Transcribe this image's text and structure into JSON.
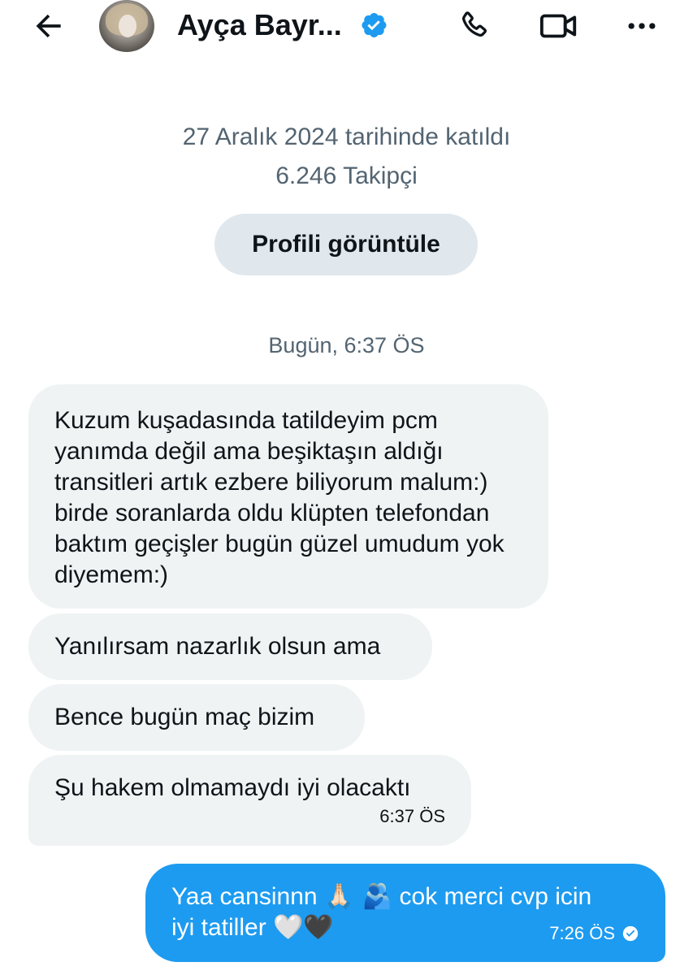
{
  "header": {
    "name": "Ayça Bayr...",
    "icons": [
      "back-arrow-icon",
      "verified-badge-icon",
      "phone-icon",
      "video-camera-icon",
      "more-icon"
    ]
  },
  "profile": {
    "joined": "27 Aralık 2024 tarihinde katıldı",
    "followers": "6.246 Takipçi",
    "view_profile_label": "Profili görüntüle"
  },
  "conversation": {
    "day_stamp": "Bugün, 6:37 ÖS",
    "incoming": [
      "Kuzum kuşadasında tatildeyim pcm yanımda değil ama beşiktaşın aldığı transitleri artık ezbere biliyorum malum:) birde soranlarda oldu klüpten telefondan baktım geçişler bugün güzel umudum yok diyemem:)",
      "Yanılırsam nazarlık olsun ama",
      "Bence bugün maç bizim",
      "Şu hakem olmamaydı iyi olacaktı"
    ],
    "incoming_time": "6:37 ÖS",
    "outgoing": {
      "text_part1": "Yaa cansinnn",
      "emoji_part1": "🙏🏻 🫂",
      "text_part2": "cok merci cvp icin",
      "text_line2": "iyi tatiller",
      "emoji_part2": "🤍🖤",
      "time": "7:26 ÖS"
    }
  },
  "colors": {
    "accent": "#1d9bf0",
    "incoming_bubble": "#eff3f4",
    "secondary_text": "#536471",
    "button_bg": "#e1e8ed"
  }
}
